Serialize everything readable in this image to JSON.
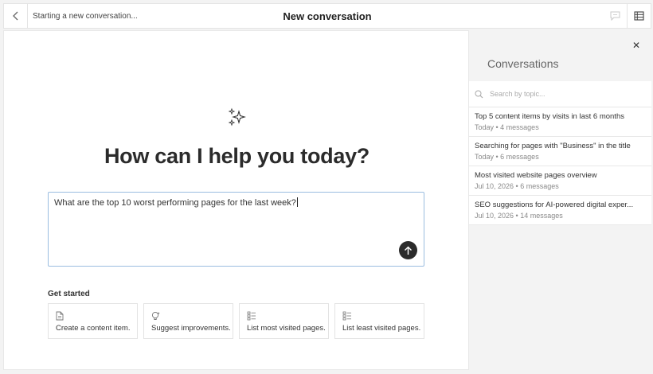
{
  "header": {
    "status": "Starting a new conversation...",
    "title": "New conversation"
  },
  "main": {
    "headline": "How can I help you today?",
    "prompt_value": "What are the top 10 worst performing pages for the last week?",
    "get_started_label": "Get started",
    "suggestions": [
      {
        "label": "Create a content item.",
        "icon": "document-icon"
      },
      {
        "label": "Suggest improvements.",
        "icon": "lightbulb-icon"
      },
      {
        "label": "List most visited pages.",
        "icon": "list-icon"
      },
      {
        "label": "List least visited pages.",
        "icon": "list-icon"
      }
    ]
  },
  "sidebar": {
    "title": "Conversations",
    "search_placeholder": "Search by topic...",
    "items": [
      {
        "title": "Top 5 content items by visits in last 6 months",
        "meta": "Today • 4 messages"
      },
      {
        "title": "Searching for pages with \"Business\" in the title",
        "meta": "Today • 6 messages"
      },
      {
        "title": "Most visited website pages overview",
        "meta": "Jul 10, 2026 • 6 messages"
      },
      {
        "title": "SEO suggestions for AI-powered digital exper...",
        "meta": "Jul 10, 2026 • 14 messages"
      }
    ]
  },
  "colors": {
    "prompt_border": "#9bbde0",
    "send_button": "#2b2b2b",
    "sidebar_bg": "#f3f3f3"
  }
}
